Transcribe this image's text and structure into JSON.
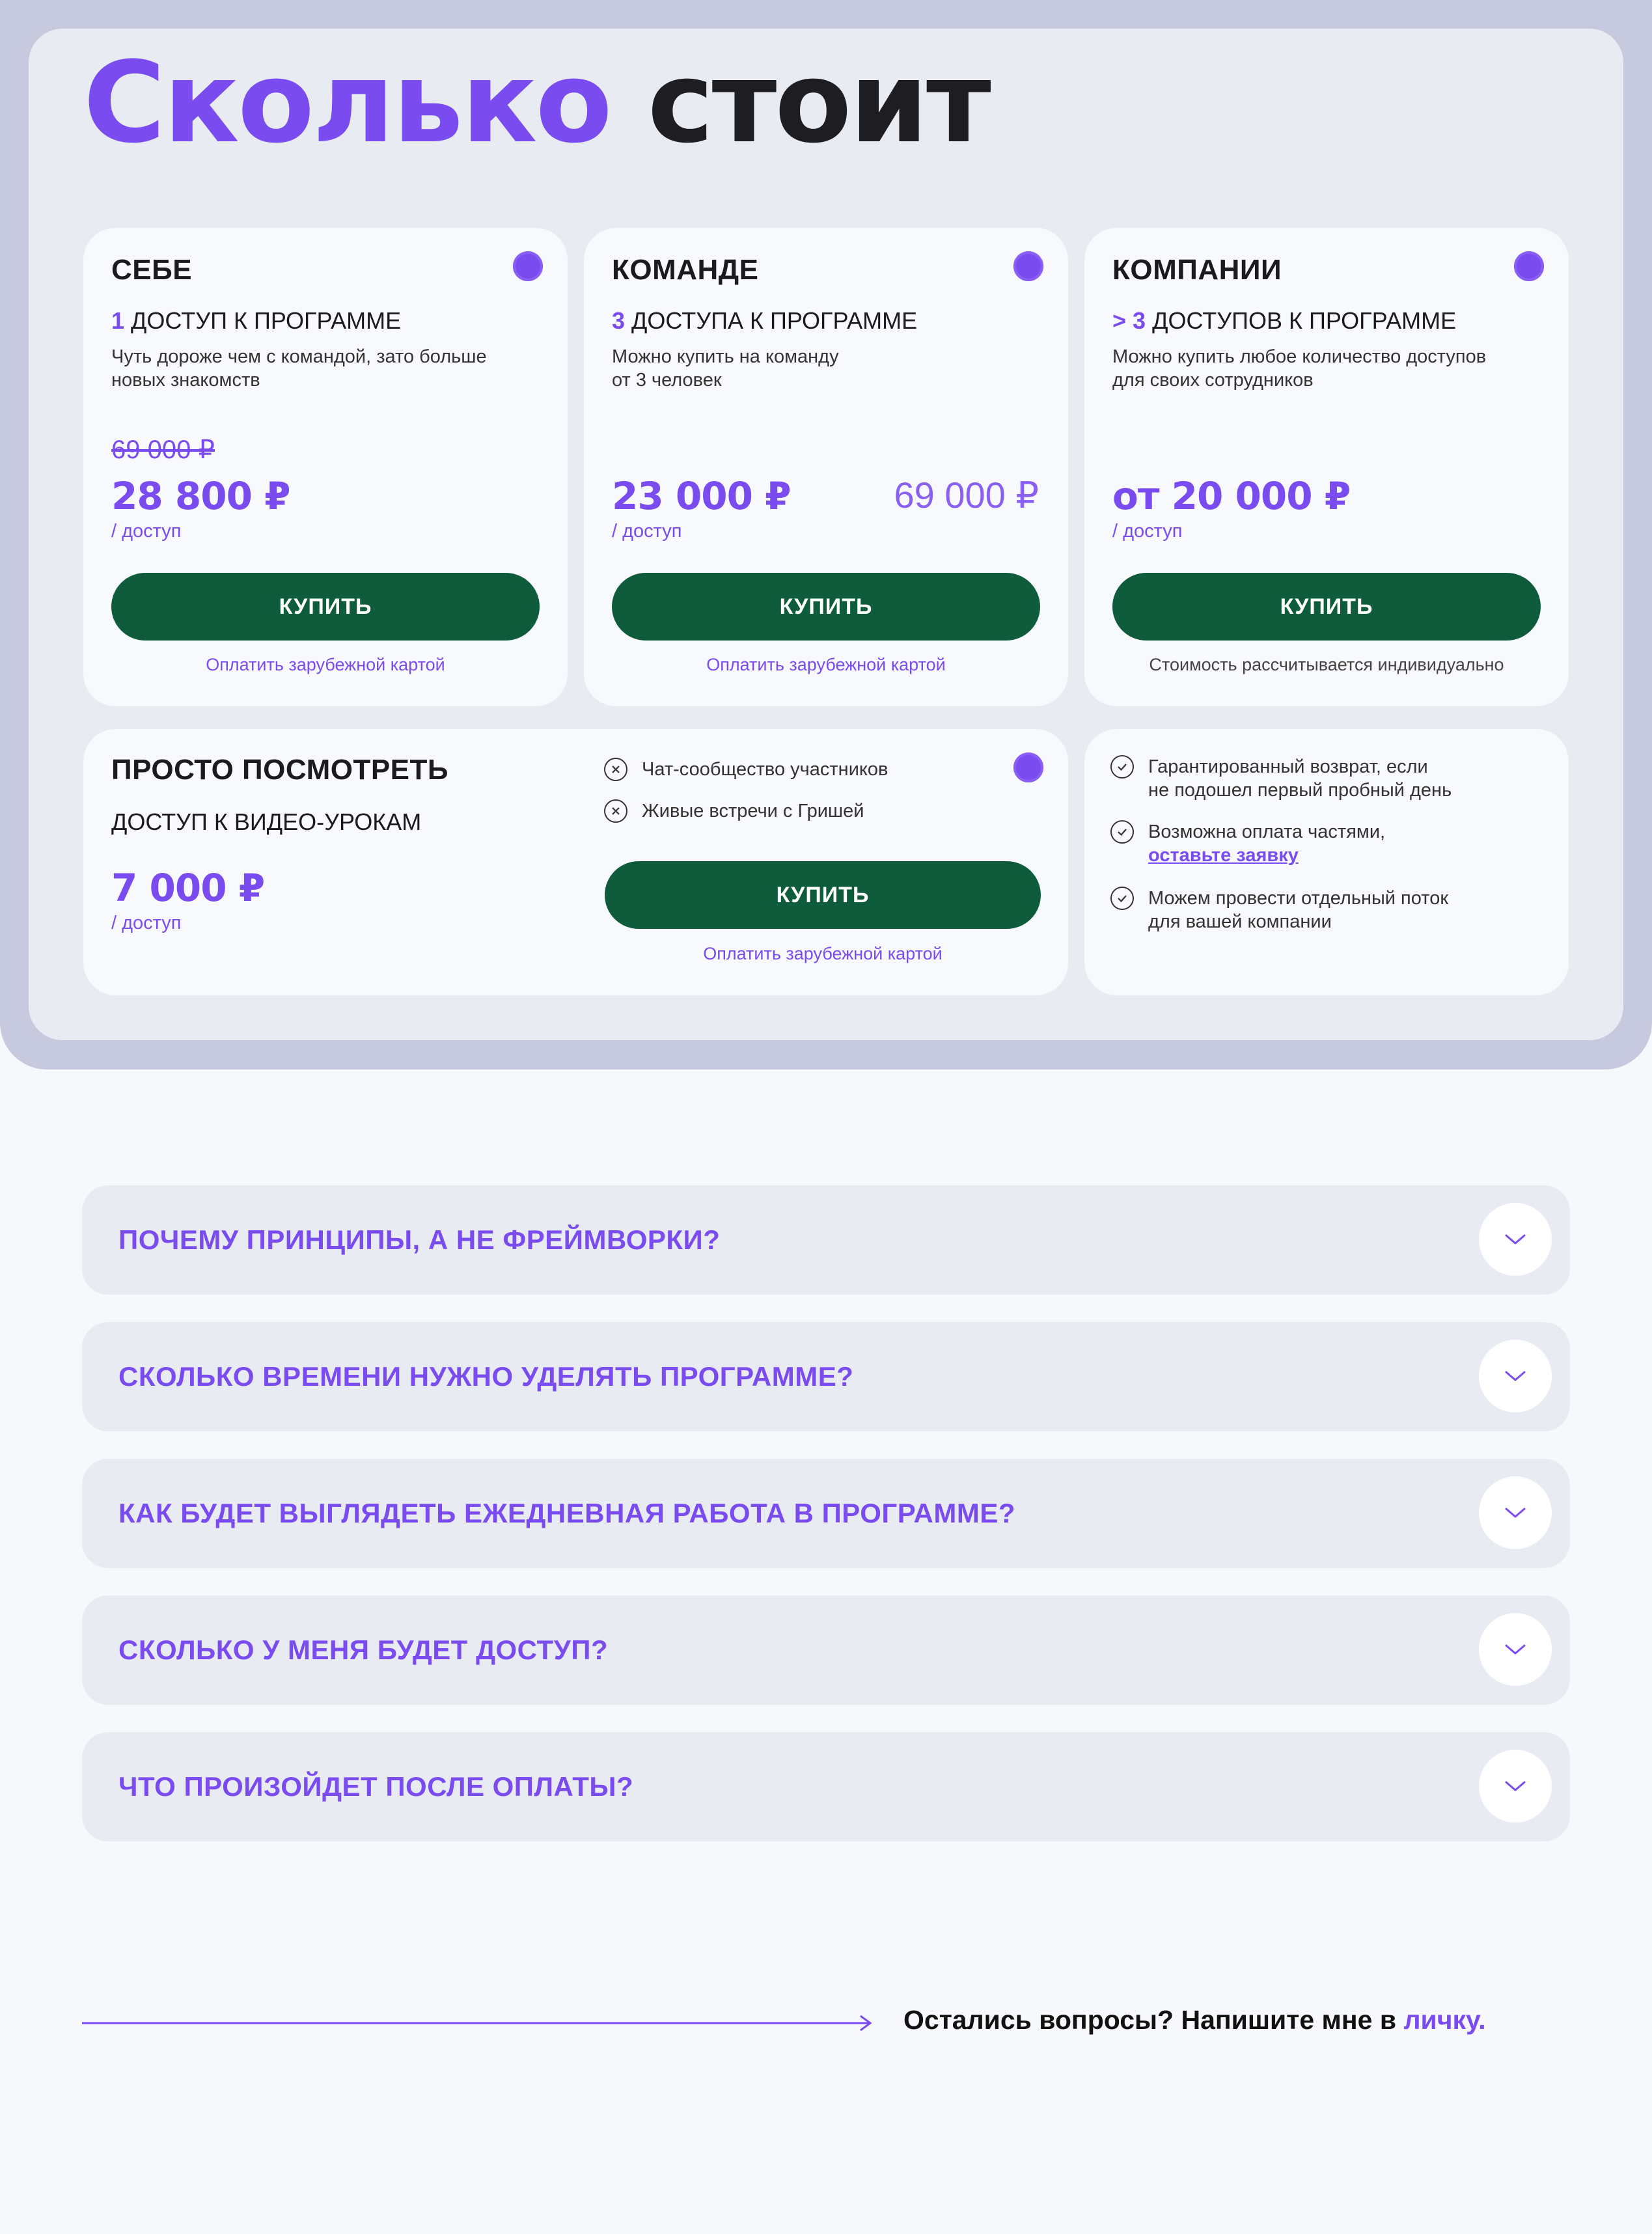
{
  "title": {
    "part1": "Сколько",
    "part2": "стоит"
  },
  "plans": [
    {
      "title": "СЕБЕ",
      "access_num": "1",
      "access_text": "ДОСТУП К ПРОГРАММЕ",
      "desc_line1": "Чуть дороже чем с командой, зато больше",
      "desc_line2": "новых знакомств",
      "old_price": "69 000 ₽",
      "price": "28 800 ₽",
      "unit": "/ доступ",
      "button": "КУПИТЬ",
      "footer": "Оплатить зарубежной картой"
    },
    {
      "title": "КОМАНДЕ",
      "access_num": "3",
      "access_text": "ДОСТУПА К ПРОГРАММЕ",
      "desc_line1": "Можно купить на команду",
      "desc_line2": "от 3 человек",
      "price": "23 000 ₽",
      "price_right": "69 000 ₽",
      "unit": "/ доступ",
      "button": "КУПИТЬ",
      "footer": "Оплатить зарубежной картой"
    },
    {
      "title": "КОМПАНИИ",
      "access_num": "> 3",
      "access_text": "ДОСТУПОВ К ПРОГРАММЕ",
      "desc_line1": "Можно купить любое количество доступов",
      "desc_line2": "для своих сотрудников",
      "price": "от 20 000 ₽",
      "unit": "/ доступ",
      "button": "КУПИТЬ",
      "footer": "Стоимость рассчитывается индивидуально"
    }
  ],
  "basic": {
    "title": "ПРОСТО ПОСМОТРЕТЬ",
    "access_text": "ДОСТУП К ВИДЕО-УРОКАМ",
    "price": "7 000 ₽",
    "unit": "/ доступ",
    "excluded": [
      "Чат-сообщество участников",
      "Живые встречи с Гришей"
    ],
    "button": "КУПИТЬ",
    "footer": "Оплатить зарубежной картой"
  },
  "guarantees": {
    "item1_line1": "Гарантированный возврат, если",
    "item1_line2": "не подошел первый пробный день",
    "item2_line1": "Возможна оплата частями,",
    "item2_link": "оставьте заявку",
    "item3_line1": "Можем провести отдельный поток",
    "item3_line2": "для вашей компании"
  },
  "faq": [
    "ПОЧЕМУ ПРИНЦИПЫ, А НЕ ФРЕЙМВОРКИ?",
    "СКОЛЬКО ВРЕМЕНИ НУЖНО УДЕЛЯТЬ ПРОГРАММЕ?",
    "КАК БУДЕТ ВЫГЛЯДЕТЬ ЕЖЕДНЕВНАЯ РАБОТА В ПРОГРАММЕ?",
    "СКОЛЬКО У МЕНЯ БУДЕТ ДОСТУП?",
    "ЧТО ПРОИЗОЙДЕТ ПОСЛЕ ОПЛАТЫ?"
  ],
  "contact": {
    "text": "Остались вопросы? Напишите мне в",
    "link": "личку."
  },
  "colors": {
    "accent": "#7a4cf0",
    "button": "#0e5c3c",
    "card": "#f8f9fc",
    "panel": "#e9ebf3",
    "frame": "#c7c9de"
  }
}
